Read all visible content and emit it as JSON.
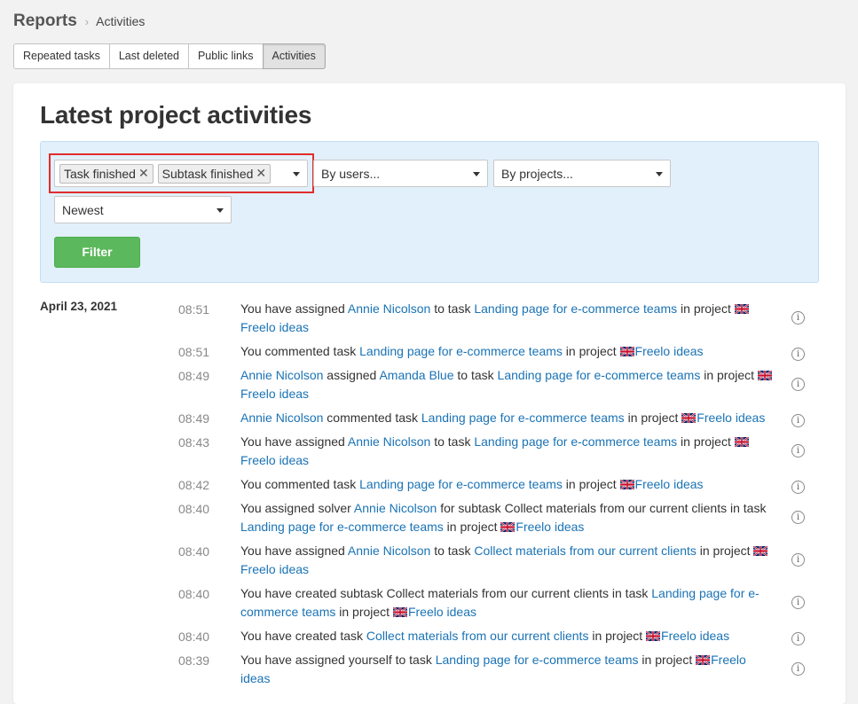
{
  "breadcrumb": {
    "root": "Reports",
    "current": "Activities"
  },
  "tabs": [
    {
      "label": "Repeated tasks",
      "active": false
    },
    {
      "label": "Last deleted",
      "active": false
    },
    {
      "label": "Public links",
      "active": false
    },
    {
      "label": "Activities",
      "active": true
    }
  ],
  "page_title": "Latest project activities",
  "filters": {
    "type_tags": [
      "Task finished",
      "Subtask finished"
    ],
    "users_placeholder": "By users...",
    "projects_placeholder": "By projects...",
    "sort_value": "Newest",
    "filter_button": "Filter",
    "highlight_color": "#e02d2d"
  },
  "colors": {
    "link": "#1a73b5",
    "button": "#5cb85c",
    "panel": "#e2f0fb"
  },
  "activity_date": "April 23, 2021",
  "activities": [
    {
      "time": "08:51",
      "parts": [
        {
          "t": "text",
          "v": "You have assigned "
        },
        {
          "t": "link",
          "v": "Annie Nicolson"
        },
        {
          "t": "text",
          "v": " to task "
        },
        {
          "t": "link",
          "v": "Landing page for e-commerce teams"
        },
        {
          "t": "text",
          "v": " in project "
        },
        {
          "t": "flag"
        },
        {
          "t": "br"
        },
        {
          "t": "link",
          "v": "Freelo ideas"
        }
      ]
    },
    {
      "time": "08:51",
      "parts": [
        {
          "t": "text",
          "v": "You commented task "
        },
        {
          "t": "link",
          "v": "Landing page for e-commerce teams"
        },
        {
          "t": "text",
          "v": " in project "
        },
        {
          "t": "flag"
        },
        {
          "t": "link",
          "v": "Freelo ideas"
        }
      ]
    },
    {
      "time": "08:49",
      "parts": [
        {
          "t": "link",
          "v": "Annie Nicolson"
        },
        {
          "t": "text",
          "v": " assigned "
        },
        {
          "t": "link",
          "v": "Amanda Blue"
        },
        {
          "t": "text",
          "v": " to task "
        },
        {
          "t": "link",
          "v": "Landing page for e-commerce teams"
        },
        {
          "t": "text",
          "v": " in project "
        },
        {
          "t": "flag"
        },
        {
          "t": "br"
        },
        {
          "t": "link",
          "v": "Freelo ideas"
        }
      ]
    },
    {
      "time": "08:49",
      "parts": [
        {
          "t": "link",
          "v": "Annie Nicolson"
        },
        {
          "t": "text",
          "v": " commented task "
        },
        {
          "t": "link",
          "v": "Landing page for e-commerce teams"
        },
        {
          "t": "text",
          "v": " in project "
        },
        {
          "t": "flag"
        },
        {
          "t": "link",
          "v": "Freelo ideas"
        }
      ]
    },
    {
      "time": "08:43",
      "parts": [
        {
          "t": "text",
          "v": "You have assigned "
        },
        {
          "t": "link",
          "v": "Annie Nicolson"
        },
        {
          "t": "text",
          "v": " to task "
        },
        {
          "t": "link",
          "v": "Landing page for e-commerce teams"
        },
        {
          "t": "text",
          "v": " in project "
        },
        {
          "t": "flag"
        },
        {
          "t": "br"
        },
        {
          "t": "link",
          "v": "Freelo ideas"
        }
      ]
    },
    {
      "time": "08:42",
      "parts": [
        {
          "t": "text",
          "v": "You commented task "
        },
        {
          "t": "link",
          "v": "Landing page for e-commerce teams"
        },
        {
          "t": "text",
          "v": " in project "
        },
        {
          "t": "flag"
        },
        {
          "t": "link",
          "v": "Freelo ideas"
        }
      ]
    },
    {
      "time": "08:40",
      "parts": [
        {
          "t": "text",
          "v": "You assigned solver "
        },
        {
          "t": "link",
          "v": "Annie Nicolson"
        },
        {
          "t": "text",
          "v": " for subtask Collect materials from our current clients in task"
        },
        {
          "t": "br"
        },
        {
          "t": "link",
          "v": "Landing page for e-commerce teams"
        },
        {
          "t": "text",
          "v": " in project "
        },
        {
          "t": "flag"
        },
        {
          "t": "link",
          "v": "Freelo ideas"
        }
      ]
    },
    {
      "time": "08:40",
      "parts": [
        {
          "t": "text",
          "v": "You have assigned "
        },
        {
          "t": "link",
          "v": "Annie Nicolson"
        },
        {
          "t": "text",
          "v": " to task "
        },
        {
          "t": "link",
          "v": "Collect materials from our current clients"
        },
        {
          "t": "text",
          "v": " in project "
        },
        {
          "t": "flag"
        },
        {
          "t": "br"
        },
        {
          "t": "link",
          "v": "Freelo ideas"
        }
      ]
    },
    {
      "time": "08:40",
      "parts": [
        {
          "t": "text",
          "v": "You have created subtask Collect materials from our current clients in task "
        },
        {
          "t": "link",
          "v": "Landing page for e-"
        },
        {
          "t": "br"
        },
        {
          "t": "link",
          "v": "commerce teams"
        },
        {
          "t": "text",
          "v": " in project "
        },
        {
          "t": "flag"
        },
        {
          "t": "link",
          "v": "Freelo ideas"
        }
      ]
    },
    {
      "time": "08:40",
      "parts": [
        {
          "t": "text",
          "v": "You have created task "
        },
        {
          "t": "link",
          "v": "Collect materials from our current clients"
        },
        {
          "t": "text",
          "v": " in project "
        },
        {
          "t": "flag"
        },
        {
          "t": "link",
          "v": "Freelo ideas"
        }
      ]
    },
    {
      "time": "08:39",
      "parts": [
        {
          "t": "text",
          "v": "You have assigned yourself to task "
        },
        {
          "t": "link",
          "v": "Landing page for e-commerce teams"
        },
        {
          "t": "text",
          "v": " in project "
        },
        {
          "t": "flag"
        },
        {
          "t": "link",
          "v": "Freelo"
        },
        {
          "t": "br"
        },
        {
          "t": "link",
          "v": "ideas"
        }
      ]
    }
  ]
}
